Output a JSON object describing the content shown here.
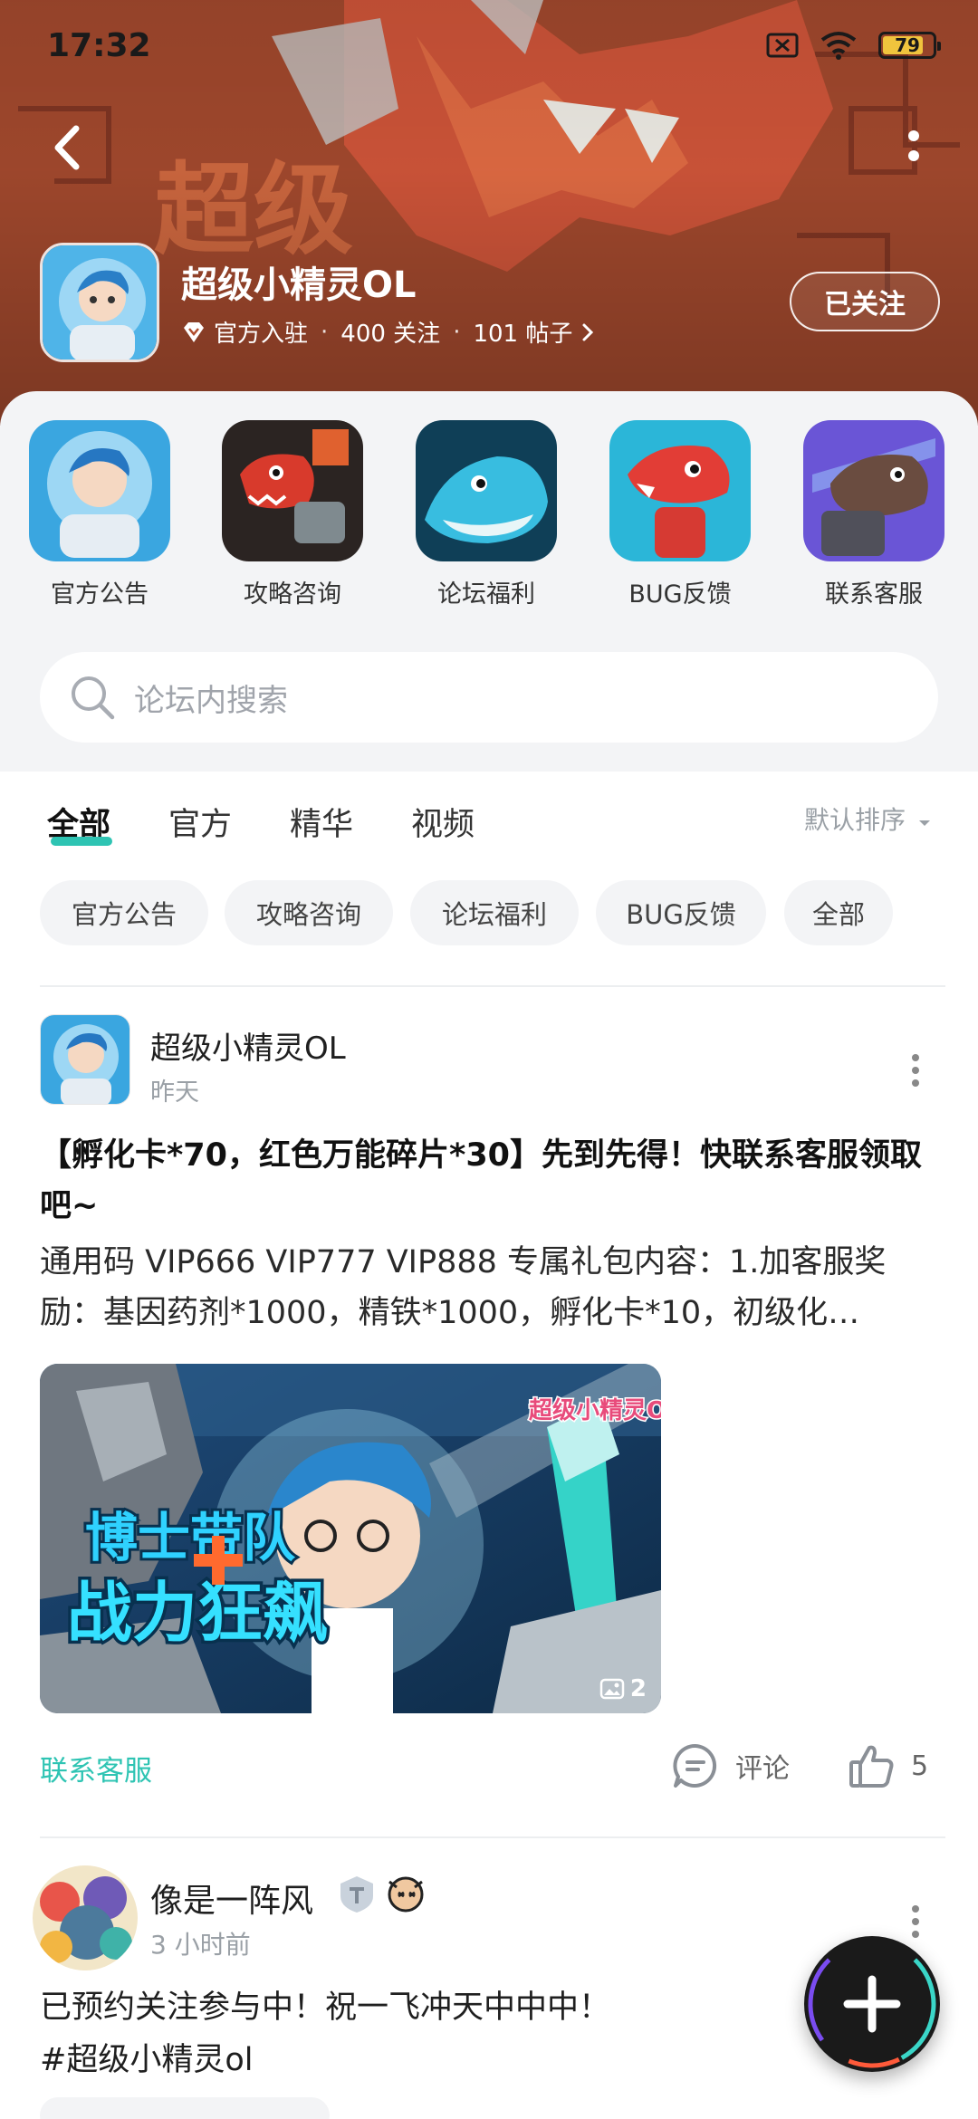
{
  "status_bar": {
    "time": "17:32",
    "battery": "79"
  },
  "forum": {
    "title": "超级小精灵OL",
    "badge_label": "官方入驻",
    "follow_count": "400 关注",
    "post_count": "101 帖子",
    "follow_button": "已关注"
  },
  "shortcuts": [
    {
      "label": "官方公告"
    },
    {
      "label": "攻略咨询"
    },
    {
      "label": "论坛福利"
    },
    {
      "label": "BUG反馈"
    },
    {
      "label": "联系客服"
    }
  ],
  "search": {
    "placeholder": "论坛内搜索"
  },
  "tabs": [
    {
      "label": "全部",
      "active": true
    },
    {
      "label": "官方"
    },
    {
      "label": "精华"
    },
    {
      "label": "视频"
    }
  ],
  "sort_label": "默认排序",
  "filter_chips": [
    "官方公告",
    "攻略咨询",
    "论坛福利",
    "BUG反馈",
    "全部"
  ],
  "posts": [
    {
      "author": "超级小精灵OL",
      "time": "昨天",
      "title": "【孵化卡*70，红色万能碎片*30】先到先得！快联系客服领取吧~",
      "body": "通用码 VIP666 VIP777 VIP888 专属礼包内容：1.加客服奖励：基因药剂*1000，精铁*1000，孵化卡*10，初级化…",
      "image_text_line1": "博士带队",
      "image_text_line2": "战力狂飙",
      "image_logo": "超级小精灵OL",
      "image_count": "2",
      "link_label": "联系客服",
      "comment_label": "评论",
      "like_count": "5"
    },
    {
      "author": "像是一阵风",
      "time": "3 小时前",
      "body_line1": "已预约关注参与中！祝一飞冲天中中中！",
      "body_line2": "#超级小精灵ol"
    }
  ],
  "colors": {
    "accent": "#2ec4b3",
    "header": "#b04e2f"
  }
}
